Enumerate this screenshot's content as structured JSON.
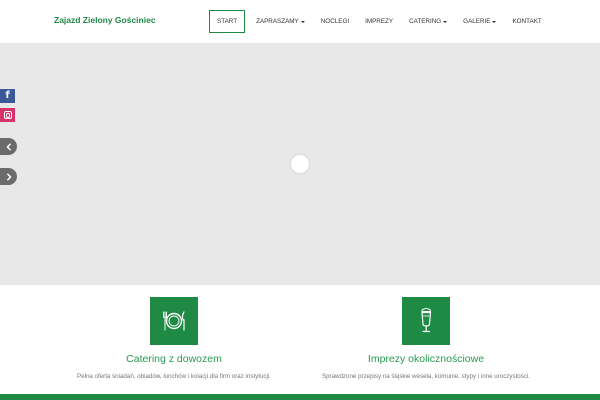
{
  "brand": {
    "name": "Zajazd Zielony Gościniec"
  },
  "nav": {
    "items": [
      {
        "label": "START",
        "active": true,
        "dropdown": false
      },
      {
        "label": "ZAPRASZAMY",
        "active": false,
        "dropdown": true
      },
      {
        "label": "NOCLEGI",
        "active": false,
        "dropdown": false
      },
      {
        "label": "IMPREZY",
        "active": false,
        "dropdown": false
      },
      {
        "label": "CATERING",
        "active": false,
        "dropdown": true
      },
      {
        "label": "GALERIE",
        "active": false,
        "dropdown": true
      },
      {
        "label": "KONTAKT",
        "active": false,
        "dropdown": false
      }
    ]
  },
  "social": {
    "facebook_icon": "facebook-icon",
    "instagram_icon": "instagram-icon"
  },
  "slider": {
    "prev_icon": "chevron-left-icon",
    "next_icon": "chevron-right-icon"
  },
  "features": [
    {
      "icon": "plate-cutlery-icon",
      "title": "Catering z dowozem",
      "description": "Pełna oferta śniadań, obiadów, lunchów i kolacji dla firm oraz instytucji."
    },
    {
      "icon": "beer-glass-icon",
      "title": "Imprezy okolicznościowe",
      "description": "Sprawdzone przepisy na śląskie wesela, komunie, stypy i inne uroczystości."
    }
  ],
  "colors": {
    "accent": "#1e8a44",
    "hero_bg": "#e8e8e8",
    "facebook": "#3b5998",
    "instagram": "#d6336c"
  }
}
